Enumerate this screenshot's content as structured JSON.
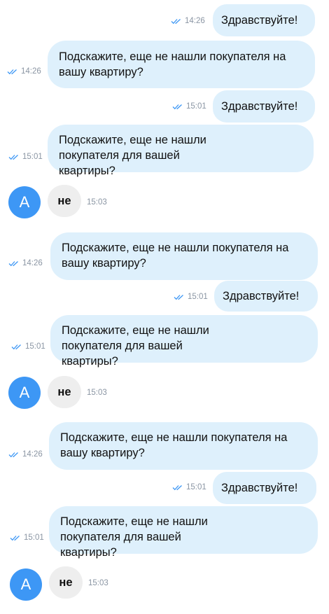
{
  "messages": [
    {
      "type": "out",
      "text": "Здравствуйте!",
      "time": "14:26"
    },
    {
      "type": "out",
      "text": "Подскажите, еще не нашли покупателя на вашу квартиру?",
      "time": "14:26"
    },
    {
      "type": "out",
      "text": "Здравствуйте!",
      "time": "15:01"
    },
    {
      "type": "out",
      "text": "Подскажите, еще не нашли покупателя для вашей квартиры?",
      "time": "15:01"
    },
    {
      "type": "in",
      "avatar": "А",
      "text": "не",
      "time": "15:03"
    },
    {
      "type": "out",
      "text": "Подскажите, еще не нашли покупателя на вашу квартиру?",
      "time": "14:26"
    },
    {
      "type": "out",
      "text": "Здравствуйте!",
      "time": "15:01"
    },
    {
      "type": "out",
      "text": "Подскажите, еще не нашли покупателя для вашей квартиры?",
      "time": "15:01"
    },
    {
      "type": "in",
      "avatar": "А",
      "text": "не",
      "time": "15:03"
    },
    {
      "type": "out",
      "text": "Подскажите, еще не нашли покупателя на вашу квартиру?",
      "time": "14:26"
    },
    {
      "type": "out",
      "text": "Здравствуйте!",
      "time": "15:01"
    },
    {
      "type": "out",
      "text": "Подскажите, еще не нашли покупателя для вашей квартиры?",
      "time": "15:01"
    },
    {
      "type": "in",
      "avatar": "А",
      "text": "не",
      "time": "15:03"
    }
  ],
  "colors": {
    "outgoing_bubble": "#def0fc",
    "incoming_bubble": "#eeeeee",
    "avatar": "#3d97f5",
    "read_ticks": "#3d97f5",
    "time_text": "#8a95a3"
  },
  "icons": {
    "read_status": "double-check-icon"
  }
}
